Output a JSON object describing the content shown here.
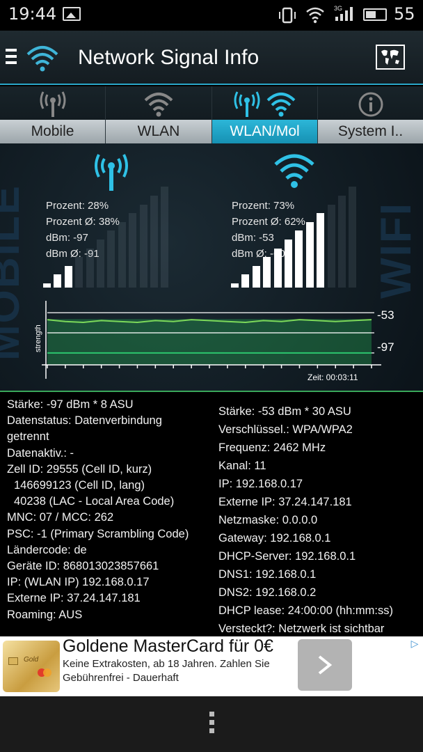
{
  "status_bar": {
    "time": "19:44",
    "network_type": "3G",
    "battery_level": "55",
    "battery_fraction": 0.55
  },
  "app_bar": {
    "title": "Network Signal Info",
    "menu_icon": "hamburger-icon",
    "map_icon": "world-map-icon"
  },
  "tabs": [
    {
      "label": "Mobile",
      "icon": "cell-tower-icon",
      "active": false
    },
    {
      "label": "WLAN",
      "icon": "wifi-icon",
      "active": false
    },
    {
      "label": "WLAN/Mol",
      "icon": "cell-tower-wifi-icon",
      "active": true
    },
    {
      "label": "System I..",
      "icon": "info-icon",
      "active": false
    }
  ],
  "graph": {
    "side_left": "MOBILE",
    "side_right": "WIFI",
    "mobile_stats": [
      "Prozent: 28%",
      "Prozent Ø: 38%",
      "dBm: -97",
      "dBm Ø: -91"
    ],
    "wifi_stats": [
      "Prozent: 73%",
      "Prozent Ø: 62%",
      "dBm: -53",
      "dBm Ø: -60"
    ],
    "mobile_percent": 28,
    "wifi_percent": 73,
    "axis_label": "strength",
    "value_wifi": "-53",
    "value_mobile": "-97",
    "time_label": "Zeit: 00:03:11"
  },
  "chart_data": {
    "type": "line",
    "title": "",
    "xlabel": "Zeit: 00:03:11",
    "ylabel": "strength",
    "series": [
      {
        "name": "",
        "color": "#7cd95a",
        "values": [
          -53,
          -55,
          -56,
          -54,
          -55,
          -56,
          -54,
          -55,
          -53,
          -54,
          -55,
          -56,
          -54,
          -55,
          -53,
          -54,
          -55,
          -54,
          -53
        ]
      },
      {
        "name": "",
        "color": "#29c46b",
        "values": [
          -97,
          -97,
          -97,
          -97,
          -97,
          -97,
          -97,
          -97,
          -97,
          -97,
          -97,
          -97,
          -97,
          -97,
          -97,
          -97,
          -97,
          -97,
          -97
        ]
      }
    ],
    "end_labels": [
      "-53",
      "-97"
    ],
    "grid": true
  },
  "mobile_info": {
    "truncated_top": "",
    "lines": [
      "Stärke: -97 dBm * 8 ASU",
      "Datenstatus: Datenverbindung",
      "getrennt",
      "Datenaktiv.: -",
      "Zell ID: 29555 (Cell ID, kurz)",
      "  146699123 (Cell ID, lang)",
      "  40238 (LAC - Local Area Code)",
      "MNC: 07 / MCC: 262",
      "PSC: -1 (Primary Scrambling Code)",
      "Ländercode: de",
      "Geräte ID: 868013023857661",
      "IP: (WLAN IP) 192.168.0.17",
      "Externe IP: 37.24.147.181",
      "Roaming: AUS"
    ]
  },
  "wlan_info": {
    "lines": [
      "Stärke: -53 dBm * 30 ASU",
      "Verschlüssel.: WPA/WPA2",
      "Frequenz: 2462 MHz",
      "Kanal: 11",
      "IP: 192.168.0.17",
      "Externe IP: 37.24.147.181",
      "Netzmaske: 0.0.0.0",
      "Gateway: 192.168.0.1",
      "DHCP-Server: 192.168.0.1",
      "DNS1: 192.168.0.1",
      "DNS2: 192.168.0.2",
      "DHCP lease: 24:00:00 (hh:mm:ss)",
      "Versteckt?: Netzwerk ist sichtbar"
    ]
  },
  "ad": {
    "title": "Goldene MasterCard für 0€",
    "description": "Keine Extrakosten, ab 18 Jahren. Zahlen Sie Gebührenfrei - Dauerhaft",
    "card_text": "Gold",
    "next_icon": "chevron-right-icon",
    "choices_icon": "ad-choices-icon",
    "page_count": 2,
    "active_page": 1
  },
  "nav_bar": {
    "menu_icon": "overflow-menu-icon"
  }
}
